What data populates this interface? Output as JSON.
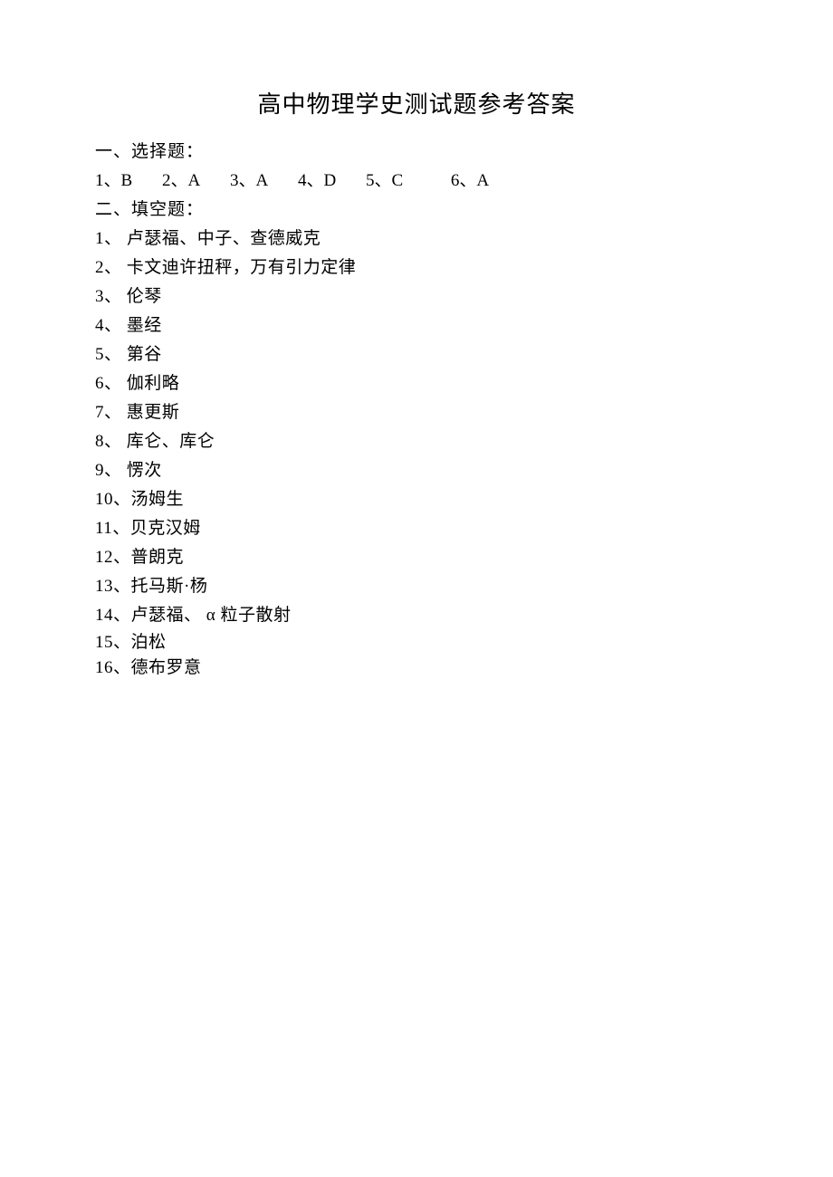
{
  "title": "高中物理学史测试题参考答案",
  "section1": {
    "header": "一、选择题：",
    "items": [
      {
        "num": "1、",
        "ans": "B"
      },
      {
        "num": "2、",
        "ans": "A"
      },
      {
        "num": "3、",
        "ans": "A"
      },
      {
        "num": "4、",
        "ans": "D"
      },
      {
        "num": "5、",
        "ans": "C"
      },
      {
        "num": "6、",
        "ans": "A"
      }
    ]
  },
  "section2": {
    "header": "二、填空题：",
    "items": [
      {
        "num": "1、 ",
        "text": "卢瑟福、中子、查德威克"
      },
      {
        "num": "2、 ",
        "text": "卡文迪许扭秤，万有引力定律"
      },
      {
        "num": "3、 ",
        "text": "伦琴"
      },
      {
        "num": "4、 ",
        "text": "墨经"
      },
      {
        "num": "5、 ",
        "text": "第谷"
      },
      {
        "num": "6、 ",
        "text": "伽利略"
      },
      {
        "num": "7、 ",
        "text": "惠更斯"
      },
      {
        "num": "8、 ",
        "text": "库仑、库仑"
      },
      {
        "num": "9、 ",
        "text": "愣次"
      },
      {
        "num": "10、",
        "text": "汤姆生"
      },
      {
        "num": "11、",
        "text": "贝克汉姆"
      },
      {
        "num": "12、",
        "text": "普朗克"
      },
      {
        "num": "13、",
        "text": "托马斯·杨"
      },
      {
        "num": "14、",
        "text": "卢瑟福、 α 粒子散射"
      },
      {
        "num": "15、",
        "text": "泊松"
      },
      {
        "num": "16、",
        "text": "德布罗意"
      }
    ]
  }
}
